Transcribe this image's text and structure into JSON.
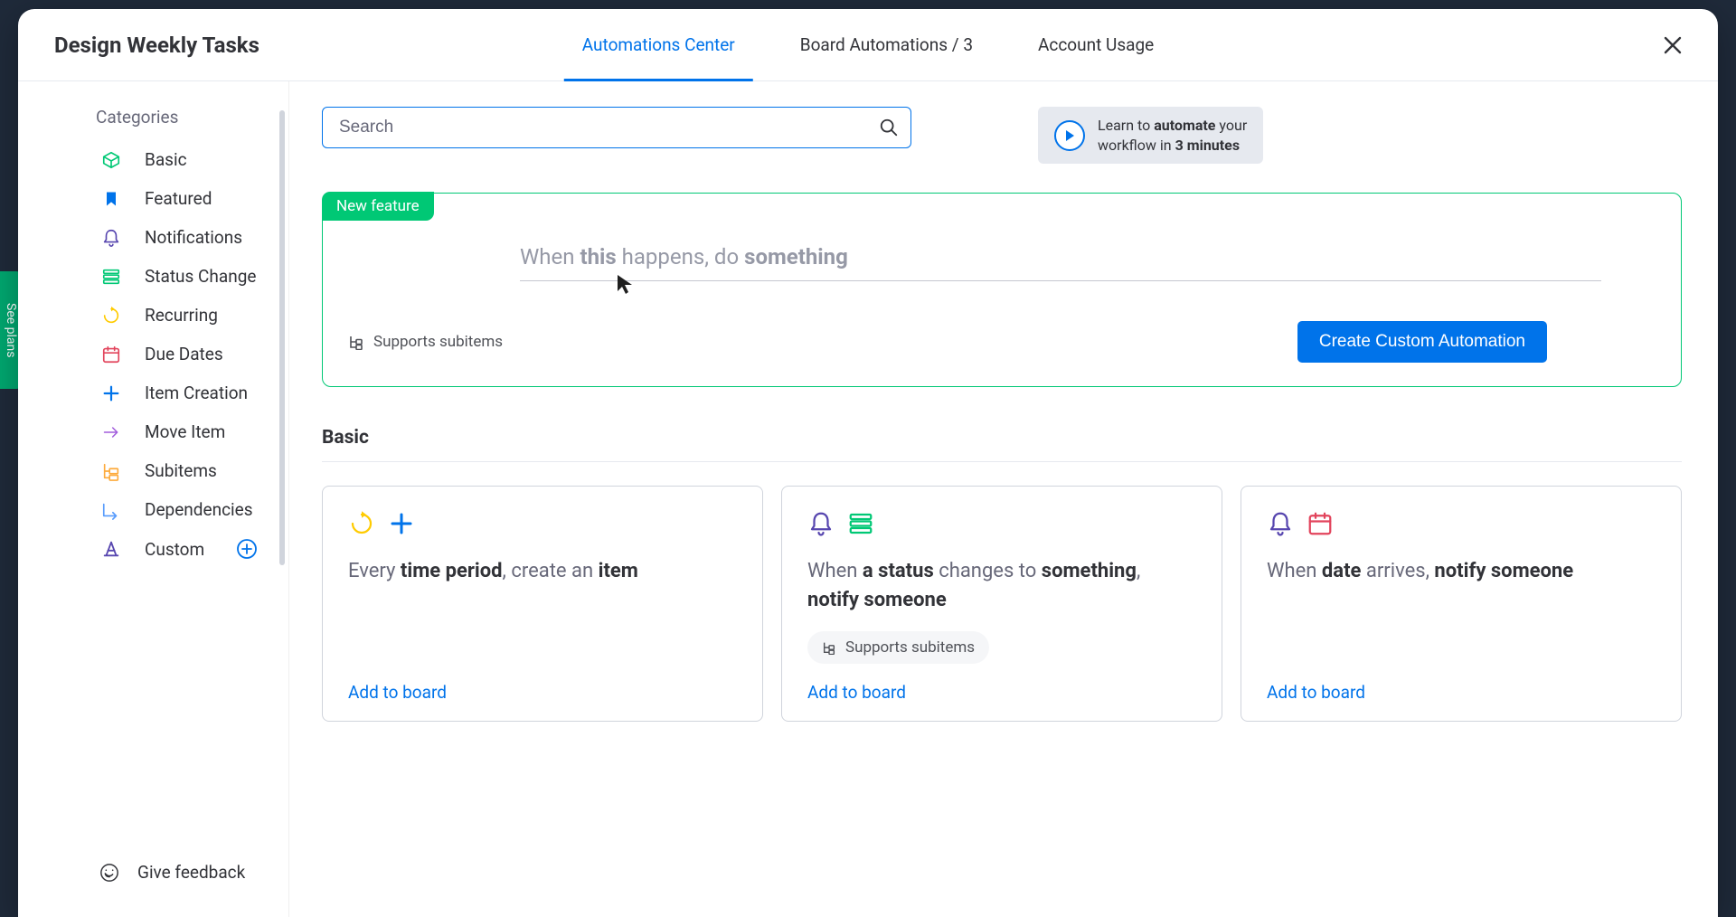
{
  "backdrop": {
    "see_plans": "See plans"
  },
  "header": {
    "title": "Design Weekly Tasks",
    "tabs": [
      {
        "label": "Automations Center",
        "active": true
      },
      {
        "label": "Board Automations / 3",
        "active": false
      },
      {
        "label": "Account Usage",
        "active": false
      }
    ]
  },
  "sidebar": {
    "title": "Categories",
    "items": [
      {
        "label": "Basic",
        "icon": "box",
        "color": "#00c875"
      },
      {
        "label": "Featured",
        "icon": "bookmark",
        "color": "#0073ea"
      },
      {
        "label": "Notifications",
        "icon": "bell",
        "color": "#5746af"
      },
      {
        "label": "Status Change",
        "icon": "status",
        "color": "#00c875"
      },
      {
        "label": "Recurring",
        "icon": "recur",
        "color": "#ffcb00"
      },
      {
        "label": "Due Dates",
        "icon": "calendar",
        "color": "#e2445c"
      },
      {
        "label": "Item Creation",
        "icon": "plus",
        "color": "#0073ea"
      },
      {
        "label": "Move Item",
        "icon": "arrow",
        "color": "#a25ddc"
      },
      {
        "label": "Subitems",
        "icon": "subitems",
        "color": "#fdab3d"
      },
      {
        "label": "Dependencies",
        "icon": "dep",
        "color": "#579bfc"
      },
      {
        "label": "Custom",
        "icon": "custom",
        "color": "#5746af",
        "has_plus": true
      }
    ],
    "feedback": "Give feedback"
  },
  "search": {
    "placeholder": "Search"
  },
  "learn": {
    "line1_a": "Learn to ",
    "line1_b": "automate",
    "line1_c": " your",
    "line2_a": "workflow in ",
    "line2_b": "3 minutes"
  },
  "feature": {
    "badge": "New feature",
    "sentence": {
      "a": "When ",
      "b": "this",
      "c": " happens, do ",
      "d": "something"
    },
    "supports": "Supports subitems",
    "button": "Create Custom Automation"
  },
  "section": {
    "title": "Basic"
  },
  "cards": [
    {
      "icons": [
        {
          "type": "recur",
          "color": "#ffcb00"
        },
        {
          "type": "plus",
          "color": "#0073ea"
        }
      ],
      "parts": [
        {
          "t": "Every ",
          "b": false
        },
        {
          "t": "time period",
          "b": true
        },
        {
          "t": ", create an ",
          "b": false
        },
        {
          "t": "item",
          "b": true
        }
      ],
      "supports": false,
      "add": "Add to board"
    },
    {
      "icons": [
        {
          "type": "bell",
          "color": "#5746af"
        },
        {
          "type": "status",
          "color": "#00c875"
        }
      ],
      "parts": [
        {
          "t": "When ",
          "b": false
        },
        {
          "t": "a status",
          "b": true
        },
        {
          "t": " changes to ",
          "b": false
        },
        {
          "t": "something",
          "b": true
        },
        {
          "t": ", ",
          "b": false
        },
        {
          "t": "notify someone",
          "b": true
        }
      ],
      "supports": true,
      "supports_label": "Supports subitems",
      "add": "Add to board"
    },
    {
      "icons": [
        {
          "type": "bell",
          "color": "#5746af"
        },
        {
          "type": "calendar",
          "color": "#e2445c"
        }
      ],
      "parts": [
        {
          "t": "When ",
          "b": false
        },
        {
          "t": "date",
          "b": true
        },
        {
          "t": " arrives, ",
          "b": false
        },
        {
          "t": "notify someone",
          "b": true
        }
      ],
      "supports": false,
      "add": "Add to board"
    }
  ]
}
